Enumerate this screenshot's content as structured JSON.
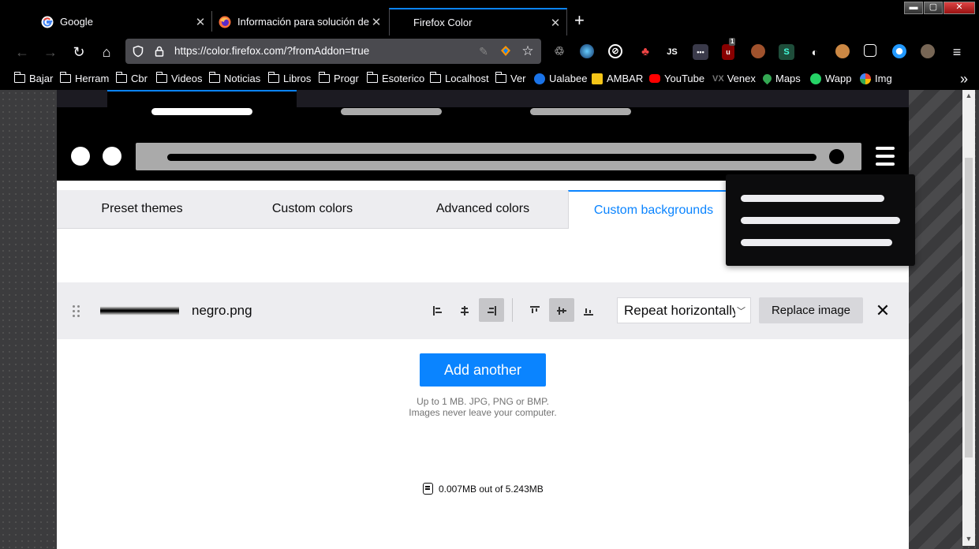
{
  "browser": {
    "tabs": [
      {
        "title": "Google",
        "favicon": "google-icon"
      },
      {
        "title": "Información para solución de pr",
        "favicon": "firefox-icon"
      },
      {
        "title": "Firefox Color",
        "favicon": "",
        "active": true
      }
    ],
    "window_controls": {
      "minimize": "▬",
      "maximize": "▢",
      "close": "✕"
    },
    "url": "https://color.firefox.com/?fromAddon=true",
    "extensions": [
      {
        "icon": "recycle-icon"
      },
      {
        "icon": "globe-icon"
      },
      {
        "icon": "compass-icon"
      },
      {
        "icon": "tree-icon"
      },
      {
        "icon": "js-icon",
        "label": "JS"
      },
      {
        "icon": "dots-icon",
        "label": "•••"
      },
      {
        "icon": "ublock-icon",
        "badge": "1"
      },
      {
        "icon": "cookie-icon"
      },
      {
        "icon": "s-icon",
        "label": "S"
      },
      {
        "icon": "cow-icon"
      },
      {
        "icon": "monkey-icon"
      },
      {
        "icon": "note-edit-icon"
      },
      {
        "icon": "blue-circle-icon"
      },
      {
        "icon": "avatar-icon"
      }
    ],
    "bookmarks": [
      {
        "label": "Bajar",
        "type": "folder"
      },
      {
        "label": "Herram",
        "type": "folder"
      },
      {
        "label": "Cbr",
        "type": "folder"
      },
      {
        "label": "Videos",
        "type": "folder"
      },
      {
        "label": "Noticias",
        "type": "folder"
      },
      {
        "label": "Libros",
        "type": "folder"
      },
      {
        "label": "Progr",
        "type": "folder"
      },
      {
        "label": "Esoterico",
        "type": "folder"
      },
      {
        "label": "Localhost",
        "type": "folder"
      },
      {
        "label": "Ver",
        "type": "folder"
      },
      {
        "label": "Ualabee",
        "type": "site",
        "color": "#1a73e8"
      },
      {
        "label": "AMBAR",
        "type": "site",
        "color": "#f5c518"
      },
      {
        "label": "YouTube",
        "type": "site",
        "color": "#ff0000"
      },
      {
        "label": "Venex",
        "type": "site",
        "color": "#777777"
      },
      {
        "label": "Maps",
        "type": "site",
        "color": "#34a853"
      },
      {
        "label": "Wapp",
        "type": "site",
        "color": "#25d366"
      },
      {
        "label": "Img",
        "type": "site",
        "color": "#4285f4"
      }
    ]
  },
  "app": {
    "tabs": [
      {
        "label": "Preset themes"
      },
      {
        "label": "Custom colors"
      },
      {
        "label": "Advanced colors"
      },
      {
        "label": "Custom backgrounds",
        "active": true
      }
    ],
    "background_item": {
      "filename": "negro.png",
      "horizontal_align": "right",
      "vertical_align": "center",
      "repeat": "Repeat horizontally",
      "replace_label": "Replace image",
      "remove_label": "✕"
    },
    "add_label": "Add another",
    "hint_line1": "Up to 1 MB. JPG, PNG or BMP.",
    "hint_line2": "Images never leave your computer.",
    "usage": "0.007MB out of 5.243MB",
    "accent_color": "#0a84ff"
  }
}
